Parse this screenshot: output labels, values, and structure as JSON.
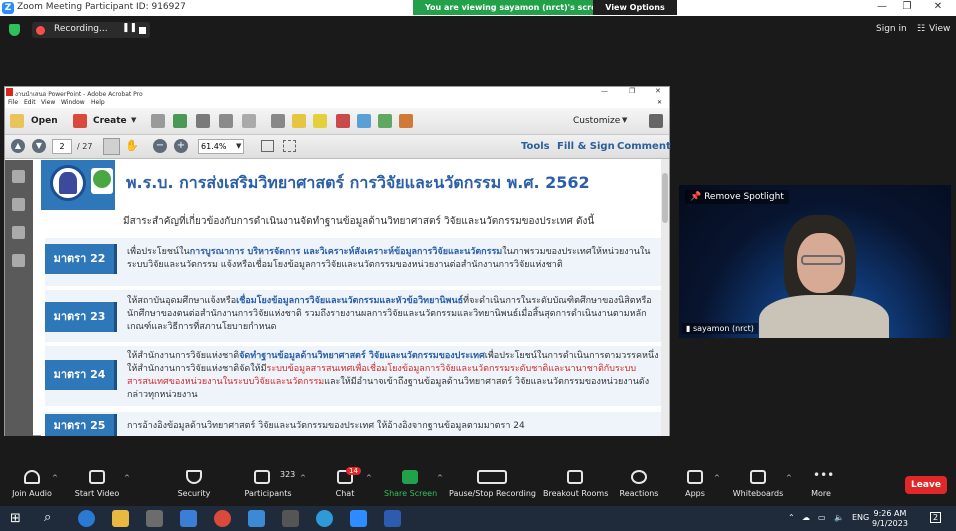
{
  "window": {
    "title": "Zoom Meeting Participant ID: 916927",
    "viewing_banner": "You are viewing sayamon (nrct)'s screen",
    "view_options": "View Options",
    "controls": {
      "minimize": "—",
      "maximize": "❐",
      "close": "✕"
    }
  },
  "meeting_bar": {
    "recording_label": "Recording...",
    "sign_in": "Sign in",
    "view": "View"
  },
  "acrobat": {
    "title": "งานนำเสนอ PowerPoint - Adobe Acrobat Pro",
    "menu": [
      "File",
      "Edit",
      "View",
      "Window",
      "Help"
    ],
    "toolbar": {
      "open": "Open",
      "create": "Create",
      "customize": "Customize",
      "page_current": "2",
      "page_total": "/ 27",
      "zoom": "61.4%",
      "tools": "Tools",
      "fill_sign": "Fill & Sign",
      "comment": "Comment"
    },
    "page": {
      "title": "พ.ร.บ. การส่งเสริมวิทยาศาสตร์ การวิจัยและนวัตกรรม พ.ศ. 2562",
      "subtitle": "มีสาระสำคัญที่เกี่ยวข้องกับการดำเนินงานจัดทำฐานข้อมูลด้านวิทยาศาสตร์ วิจัยและนวัตกรรมของประเทศ ดังนี้",
      "sections": [
        {
          "tag": "มาตรา 22",
          "pre": "เพื่อประโยชน์ใน",
          "hl": "การบูรณาการ บริหารจัดการ และวิเคราะห์สังเคราะห์ข้อมูลการวิจัยและนวัตกรรม",
          "post": "ในภาพรวมของประเทศให้หน่วยงานในระบบวิจัยและนวัตกรรม แจ้งหรือเชื่อมโยงข้อมูลการวิจัยและนวัตกรรมของหน่วยงานต่อสำนักงานการวิจัยแห่งชาติ"
        },
        {
          "tag": "มาตรา 23",
          "pre": "ให้สถาบันอุดมศึกษาแจ้งหรือ",
          "hl": "เชื่อมโยงข้อมูลการวิจัยและนวัตกรรมและหัวข้อวิทยานิพนธ์",
          "post": "ที่จะดำเนินการในระดับบัณฑิตศึกษาของนิสิตหรือนักศึกษาของตนต่อสำนักงานการวิจัยแห่งชาติ รวมถึงรายงานผลการวิจัยและนวัตกรรมและวิทยานิพนธ์เมื่อสิ้นสุดการดำเนินงานตามหลักเกณฑ์และวิธีการที่สภานโยบายกำหนด"
        },
        {
          "tag": "มาตรา 24",
          "pre": "ให้สำนักงานการวิจัยแห่งชาติ",
          "hl": "จัดทำฐานข้อมูลด้านวิทยาศาสตร์ วิจัยและนวัตกรรมของประเทศ",
          "mid": "เพื่อประโยชน์ในการดำเนินการตามวรรคหนึ่ง ให้สำนักงานการวิจัยแห่งชาติจัดให้มี",
          "red": "ระบบข้อมูลสารสนเทศเพื่อเชื่อมโยงข้อมูลการวิจัยและนวัตกรรมระดับชาติและนานาชาติกับระบบสารสนเทศของหน่วยงานในระบบวิจัยและนวัตกรรม",
          "post": "และให้มีอำนาจเข้าถึงฐานข้อมูลด้านวิทยาศาสตร์ วิจัยและนวัตกรรมของหน่วยงานดังกล่าวทุกหน่วยงาน"
        },
        {
          "tag": "มาตรา 25",
          "pre": "การอ้างอิงข้อมูลด้านวิทยาศาสตร์ วิจัยและนวัตกรรมของประเทศ ให้อ้างอิงจากฐานข้อมูลตามมาตรา 24"
        }
      ]
    }
  },
  "video": {
    "remove_spotlight": "Remove Spotlight",
    "participant_name": "sayamon (nrct)"
  },
  "zoom_toolbar": {
    "join_audio": "Join Audio",
    "start_video": "Start Video",
    "security": "Security",
    "participants": "Participants",
    "participants_count": "323",
    "chat": "Chat",
    "chat_badge": "14",
    "share_screen": "Share Screen",
    "record": "Pause/Stop Recording",
    "breakout": "Breakout Rooms",
    "reactions": "Reactions",
    "apps": "Apps",
    "whiteboards": "Whiteboards",
    "more": "More",
    "leave": "Leave"
  },
  "taskbar": {
    "language": "ENG",
    "time": "9:26 AM",
    "date": "9/1/2023",
    "notification_count": "2"
  }
}
